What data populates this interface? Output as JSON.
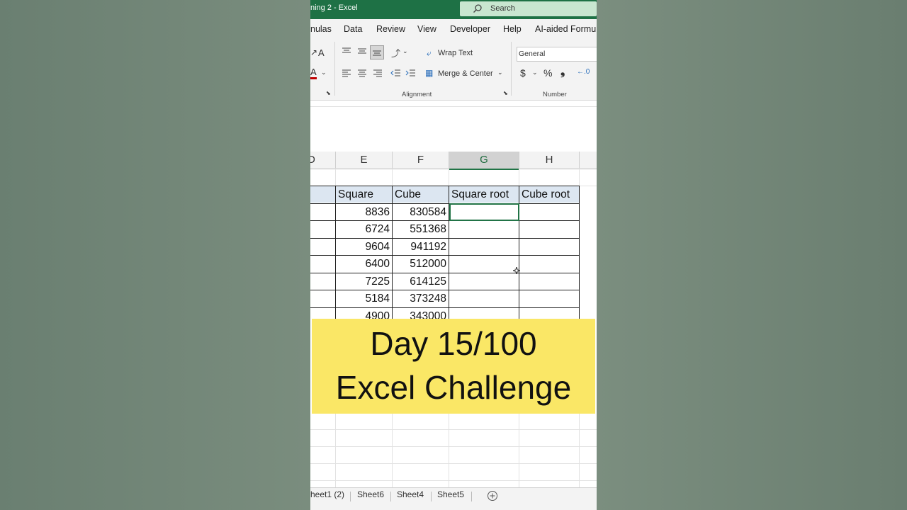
{
  "window": {
    "title": "ning 2  -  Excel",
    "search_placeholder": "Search"
  },
  "menu": [
    "nulas",
    "Data",
    "Review",
    "View",
    "Developer",
    "Help",
    "AI-aided Formu"
  ],
  "ribbon": {
    "font_size_label": "A",
    "font_color_label": "A",
    "wrap_text": "Wrap Text",
    "merge_center": "Merge & Center",
    "alignment_group": "Alignment",
    "number_format": "General",
    "currency": "$",
    "percent": "%",
    "comma": "\t",
    "number_group": "Number"
  },
  "grid": {
    "columns": [
      "D",
      "E",
      "F",
      "G",
      "H"
    ],
    "selected_column": "G",
    "headers": [
      "Square",
      "Cube",
      "Square root",
      "Cube root"
    ],
    "rows": [
      [
        "8836",
        "830584"
      ],
      [
        "6724",
        "551368"
      ],
      [
        "9604",
        "941192"
      ],
      [
        "6400",
        "512000"
      ],
      [
        "7225",
        "614125"
      ],
      [
        "5184",
        "373248"
      ],
      [
        "4900",
        "343000"
      ]
    ]
  },
  "banner": {
    "line1": "Day 15/100",
    "line2": "Excel Challenge"
  },
  "sheets": [
    "heet1 (2)",
    "Sheet6",
    "Sheet4",
    "Sheet5"
  ],
  "colors": {
    "excel_green": "#1e7145",
    "header_fill": "#dce6f1",
    "banner_yellow": "#fae766"
  }
}
